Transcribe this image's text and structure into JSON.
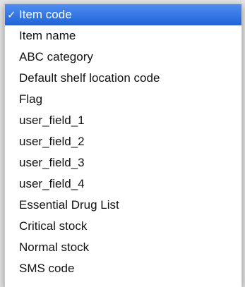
{
  "menu": {
    "items": [
      {
        "label": "Item code",
        "checked": true,
        "check_glyph": "✓"
      },
      {
        "label": "Item name"
      },
      {
        "label": "ABC category"
      },
      {
        "label": "Default shelf location code"
      },
      {
        "label": "Flag"
      },
      {
        "label": "user_field_1"
      },
      {
        "label": "user_field_2"
      },
      {
        "label": "user_field_3"
      },
      {
        "label": "user_field_4"
      },
      {
        "label": "Essential Drug List"
      },
      {
        "label": "Critical stock"
      },
      {
        "label": "Normal stock"
      },
      {
        "label": "SMS code"
      }
    ],
    "selected_color": "#2f72e6"
  }
}
